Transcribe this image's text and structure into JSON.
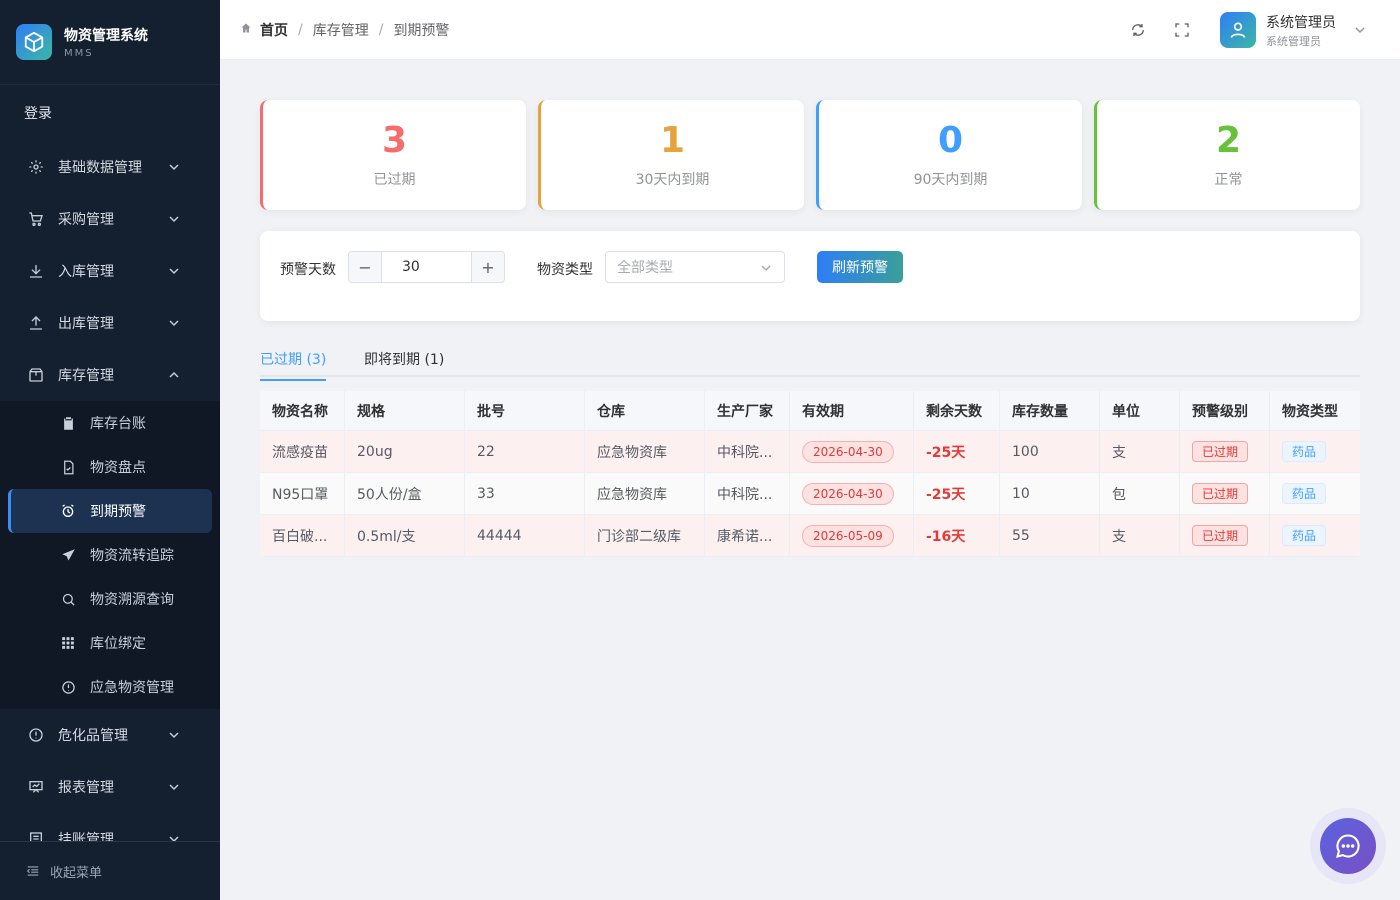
{
  "app": {
    "title": "物资管理系统",
    "subtitle": "MMS"
  },
  "sidebar": {
    "login": "登录",
    "menus": [
      {
        "label": "基础数据管理",
        "icon": "gear-icon"
      },
      {
        "label": "采购管理",
        "icon": "cart-icon"
      },
      {
        "label": "入库管理",
        "icon": "download-icon"
      },
      {
        "label": "出库管理",
        "icon": "upload-icon"
      },
      {
        "label": "库存管理",
        "icon": "package-icon"
      }
    ],
    "submenu": [
      {
        "label": "库存台账",
        "icon": "clipboard-icon"
      },
      {
        "label": "物资盘点",
        "icon": "document-check-icon"
      },
      {
        "label": "到期预警",
        "icon": "alarm-clock-icon"
      },
      {
        "label": "物资流转追踪",
        "icon": "send-icon"
      },
      {
        "label": "物资溯源查询",
        "icon": "search-icon"
      },
      {
        "label": "库位绑定",
        "icon": "grid-icon"
      },
      {
        "label": "应急物资管理",
        "icon": "warning-circle-icon"
      }
    ],
    "menus_after": [
      {
        "label": "危化品管理",
        "icon": "warning-circle-icon"
      },
      {
        "label": "报表管理",
        "icon": "presentation-icon"
      },
      {
        "label": "挂账管理",
        "icon": "list-icon"
      }
    ],
    "collapse": "收起菜单"
  },
  "header": {
    "breadcrumb": [
      "首页",
      "库存管理",
      "到期预警"
    ],
    "user_name": "系统管理员",
    "user_role": "系统管理员"
  },
  "stats": [
    {
      "value": "3",
      "label": "已过期",
      "color": "#f56c6c"
    },
    {
      "value": "1",
      "label": "30天内到期",
      "color": "#e6a23c"
    },
    {
      "value": "0",
      "label": "90天内到期",
      "color": "#409eff"
    },
    {
      "value": "2",
      "label": "正常",
      "color": "#67c23a"
    }
  ],
  "filter": {
    "days_label": "预警天数",
    "days_value": "30",
    "minus": "−",
    "plus": "+",
    "type_label": "物资类型",
    "type_placeholder": "全部类型",
    "refresh": "刷新预警"
  },
  "tabs": [
    "已过期 (3)",
    "即将到期 (1)"
  ],
  "table": {
    "headers": [
      "物资名称",
      "规格",
      "批号",
      "仓库",
      "生产厂家",
      "有效期",
      "剩余天数",
      "库存数量",
      "单位",
      "预警级别",
      "物资类型"
    ],
    "rows": [
      [
        "流感疫苗",
        "20ug",
        "22",
        "应急物资库",
        "中科院...",
        "2026-04-30",
        "-25天",
        "100",
        "支",
        "已过期",
        "药品"
      ],
      [
        "N95口罩",
        "50人份/盒",
        "33",
        "应急物资库",
        "中科院...",
        "2026-04-30",
        "-25天",
        "10",
        "包",
        "已过期",
        "药品"
      ],
      [
        "百白破...",
        "0.5ml/支",
        "44444",
        "门诊部二级库",
        "康希诺...",
        "2026-05-09",
        "-16天",
        "55",
        "支",
        "已过期",
        "药品"
      ]
    ]
  }
}
